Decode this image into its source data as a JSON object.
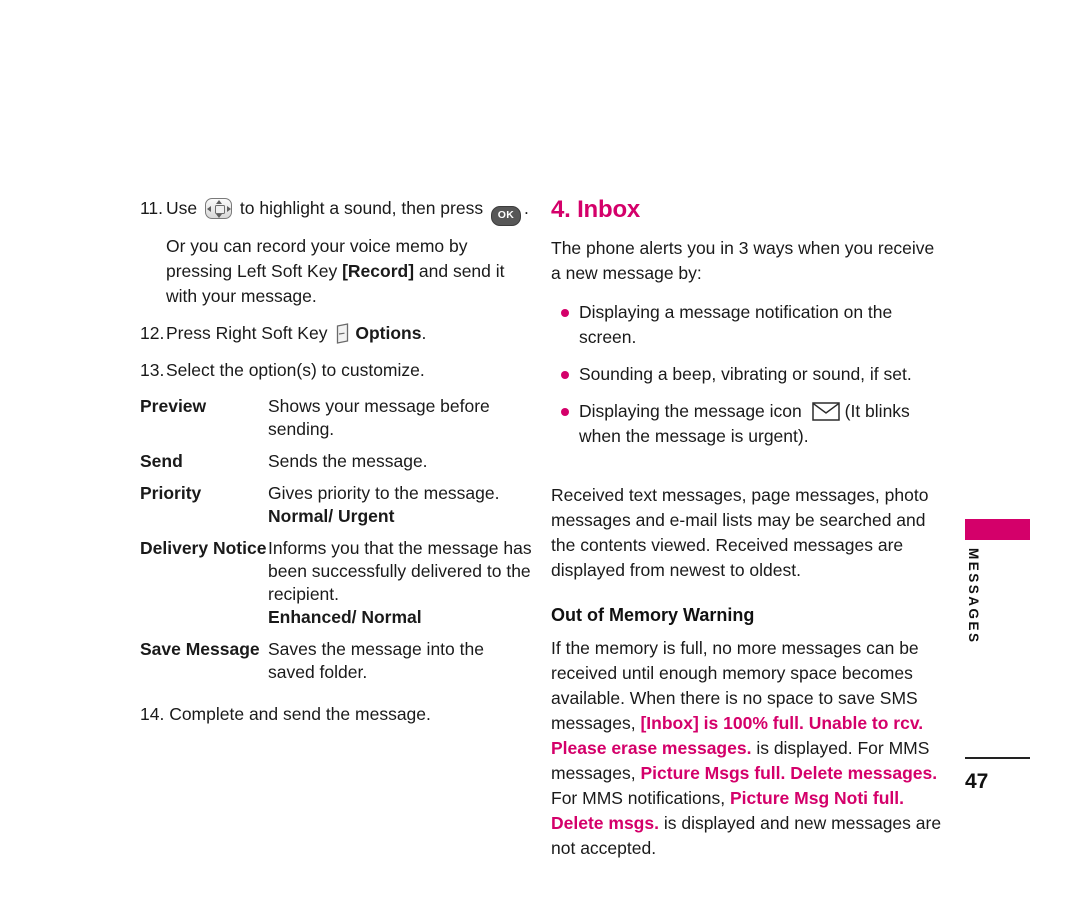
{
  "document": {
    "page_number": "47",
    "side_tab_label": "MESSAGES",
    "accent_color": "#d4006a",
    "text_color": "#1a1a1a"
  },
  "left_column": {
    "steps": [
      {
        "number": "11.",
        "text_before_navkey": "Use",
        "nav_icon": "navigation-key-icon",
        "text_middle": "to highlight a sound, then press",
        "ok_icon": "ok-key-icon",
        "ok_label": "OK",
        "text_after": ".",
        "continuation": "Or you can record your voice memo by pressing Left Soft Key [Record] and send it with your message.",
        "continuation_plain_1": "Or you can record your voice memo by pressing Left Soft Key ",
        "continuation_bold": "[Record]",
        "continuation_plain_2": " and send it with your message."
      },
      {
        "number": "12.",
        "text_before_softkey": "Press Right Soft Key",
        "soft_icon": "soft-key-icon",
        "bold_label": "Options",
        "text_after": "."
      },
      {
        "number": "13.",
        "text": "Select the option(s) to customize."
      }
    ],
    "options_table": [
      {
        "term": "Preview",
        "description": "Shows your message before sending.",
        "values": ""
      },
      {
        "term": "Send",
        "description": "Sends the message.",
        "values": ""
      },
      {
        "term": "Priority",
        "description": "Gives priority to the message.",
        "values": "Normal/ Urgent"
      },
      {
        "term": "Delivery Notice",
        "description": "Informs you that the message has been successfully delivered to the recipient.",
        "values": "Enhanced/ Normal"
      },
      {
        "term": "Save Message",
        "description": "Saves the message into the saved folder.",
        "values": ""
      }
    ],
    "final_step": "14. Complete and send the message."
  },
  "right_column": {
    "section_title": "4. Inbox",
    "intro": "The phone alerts you in 3 ways when you receive a new message by:",
    "bullets": [
      {
        "text": "Displaying a message notification on the screen.",
        "icon": ""
      },
      {
        "text": "Sounding a beep, vibrating or sound, if set.",
        "icon": ""
      },
      {
        "text_before_icon": "Displaying the message icon",
        "icon": "envelope-icon",
        "text_after_icon": "(It blinks when the message is urgent)."
      }
    ],
    "body_paragraph": "Received text messages, page messages, photo messages and e-mail lists may be searched and the contents viewed. Received messages are displayed from newest to oldest.",
    "sub_title": "Out of Memory Warning",
    "warning_paragraph": {
      "p1": "If the memory is full, no more messages can be received until enough memory space becomes available. When there is no space to save SMS messages, ",
      "alert1": "[Inbox] is 100% full. Unable to rcv. Please erase messages.",
      "p2": " is displayed. For MMS messages, ",
      "alert2": "Picture Msgs full. Delete  messages.",
      "p3": " For MMS notifications, ",
      "alert3": "Picture Msg Noti full. Delete msgs.",
      "p4": " is displayed and new messages are not accepted."
    }
  }
}
